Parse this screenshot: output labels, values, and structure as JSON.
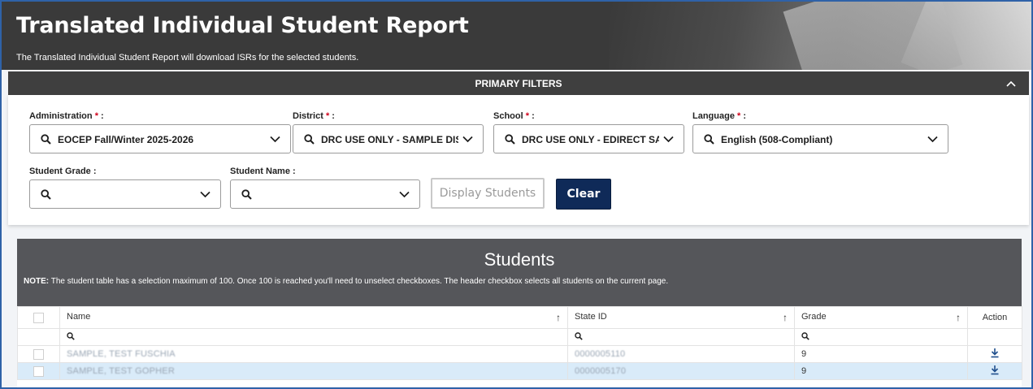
{
  "header": {
    "title": "Translated Individual Student Report",
    "subtitle": "The Translated Individual Student Report will download ISRs for the selected students."
  },
  "primary_filters": {
    "title": "PRIMARY FILTERS",
    "administration": {
      "label": "Administration",
      "required": "*",
      "colon": " :",
      "value": "EOCEP Fall/Winter 2025-2026"
    },
    "district": {
      "label": "District",
      "required": "*",
      "colon": " :",
      "value": "DRC USE ONLY - SAMPLE DIST..."
    },
    "school": {
      "label": "School",
      "required": "*",
      "colon": " :",
      "value": "DRC USE ONLY - EDIRECT SAM..."
    },
    "language": {
      "label": "Language",
      "required": "*",
      "colon": " :",
      "value": "English (508-Compliant)"
    },
    "student_grade": {
      "label": "Student Grade :",
      "value": ""
    },
    "student_name": {
      "label": "Student Name :",
      "value": ""
    },
    "display_button": "Display Students",
    "clear_button": "Clear"
  },
  "students": {
    "title": "Students",
    "note_bold": "NOTE:",
    "note_text": " The student table has a selection maximum of 100. Once 100 is reached you'll need to unselect checkboxes. The header checkbox selects all students on the current page.",
    "columns": {
      "name": "Name",
      "state_id": "State ID",
      "grade": "Grade",
      "action": "Action"
    },
    "sort_glyph": "↑",
    "rows": [
      {
        "name": "SAMPLE, TEST FUSCHIA",
        "state_id": "0000005110",
        "grade": "9"
      },
      {
        "name": "SAMPLE, TEST GOPHER",
        "state_id": "0000005170",
        "grade": "9"
      }
    ]
  },
  "colors": {
    "banner": "#3a3a3a",
    "filters_bar": "#3f3f3f",
    "students_header": "#55565a",
    "clear_button": "#0f2a58",
    "required": "#d0021b",
    "selected_row": "#d9ebf9"
  }
}
